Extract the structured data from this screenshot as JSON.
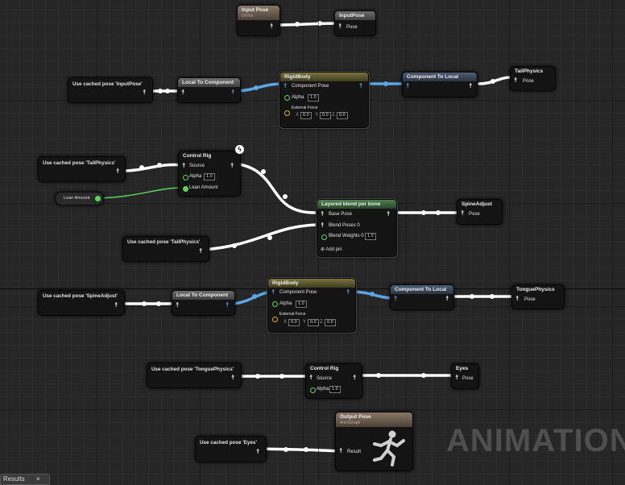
{
  "nodes": {
    "input_pose": {
      "title": "Input Pose",
      "subtitle": "DnTen",
      "pin": "Pose"
    },
    "input_pose_out": {
      "title": "InputPose",
      "pin": "Pose"
    },
    "cached_inputpose": {
      "label": "Use cached pose 'InputPose'"
    },
    "local_to_component_1": {
      "title": "Local To Component"
    },
    "rigidbody_1": {
      "title": "RigidBody",
      "component_pose": "Component Pose",
      "alpha_label": "Alpha",
      "alpha_value": "1.0",
      "external_force": "External Force",
      "x_label": "X",
      "x_value": "0.0",
      "y_label": "Y",
      "y_value": "0.0",
      "z_label": "Z",
      "z_value": "0.0"
    },
    "component_to_local_1": {
      "title": "Component To Local"
    },
    "tailphysics": {
      "title": "TailPhysics",
      "pin": "Pose"
    },
    "cached_tailphysics_1": {
      "label": "Use cached pose 'TailPhysics'"
    },
    "control_rig_1": {
      "title": "Control Rig",
      "source": "Source",
      "alpha_label": "Alpha",
      "alpha_value": "1.0",
      "lean_amount": "Lean Amount"
    },
    "lean_amount_var": {
      "label": "Lean Amount"
    },
    "layered_blend": {
      "title": "Layered blend per bone",
      "base_pose": "Base Pose",
      "blend_poses": "Blend Poses 0",
      "blend_weights": "Blend Weights 0",
      "blend_value": "1.0",
      "add_pin": "Add pin"
    },
    "spineadjust": {
      "title": "SpineAdjust",
      "pin": "Pose"
    },
    "cached_tailphysics_2": {
      "label": "Use cached pose 'TailPhysics'"
    },
    "cached_spineadjust": {
      "label": "Use cached pose 'SpineAdjust'"
    },
    "local_to_component_2": {
      "title": "Local To Component"
    },
    "rigidbody_2": {
      "title": "RigidBody",
      "component_pose": "Component Pose",
      "alpha_label": "Alpha",
      "alpha_value": "1.0",
      "external_force": "External Force",
      "x_label": "X",
      "x_value": "0.0",
      "y_label": "Y",
      "y_value": "0.0",
      "z_label": "Z",
      "z_value": "0.0"
    },
    "component_to_local_2": {
      "title": "Component To Local"
    },
    "tonguephysics": {
      "title": "TonguePhysics",
      "pin": "Pose"
    },
    "cached_tonguephysics": {
      "label": "Use cached pose 'TonguePhysics'"
    },
    "control_rig_2": {
      "title": "Control Rig",
      "source": "Source",
      "alpha_label": "Alpha",
      "alpha_value": "1.0"
    },
    "eyes": {
      "title": "Eyes",
      "pin": "Pose"
    },
    "cached_eyes": {
      "label": "Use cached pose 'Eyes'"
    },
    "output_pose": {
      "title": "Output Pose",
      "subtitle": "AnimGraph",
      "pin": "Result"
    }
  },
  "watermark": "ANIMATION",
  "bottom_tab": {
    "label": "Results",
    "close": "×"
  },
  "icons": {
    "pose_pin": "pose-person-icon",
    "lightning": "lightning-icon"
  },
  "colors": {
    "pose_wire": "#ffffff",
    "component_wire": "#5aa6e6",
    "float_wire": "#5cd45c",
    "rigidbody_header": "#7a7440",
    "blend_header": "#4f8050"
  }
}
